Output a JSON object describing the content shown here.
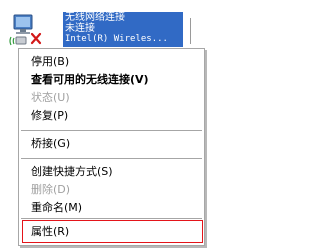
{
  "connection": {
    "icon": "network-adapter-disconnected-icon",
    "name": "无线网络连接",
    "status": "未连接",
    "device": "Intel(R) Wireles..."
  },
  "menu": {
    "items": [
      {
        "label": "停用(B)",
        "bold": false,
        "disabled": false
      },
      {
        "label": "查看可用的无线连接(V)",
        "bold": true,
        "disabled": false
      },
      {
        "label": "状态(U)",
        "bold": false,
        "disabled": true
      },
      {
        "label": "修复(P)",
        "bold": false,
        "disabled": false
      },
      {
        "label": "桥接(G)",
        "bold": false,
        "disabled": false
      },
      {
        "label": "创建快捷方式(S)",
        "bold": false,
        "disabled": false
      },
      {
        "label": "删除(D)",
        "bold": false,
        "disabled": true
      },
      {
        "label": "重命名(M)",
        "bold": false,
        "disabled": false
      },
      {
        "label": "属性(R)",
        "bold": false,
        "disabled": false
      }
    ]
  },
  "colors": {
    "selection": "#316ac5",
    "highlight_border": "#e4141a",
    "disabled_text": "#a0a0a0"
  }
}
